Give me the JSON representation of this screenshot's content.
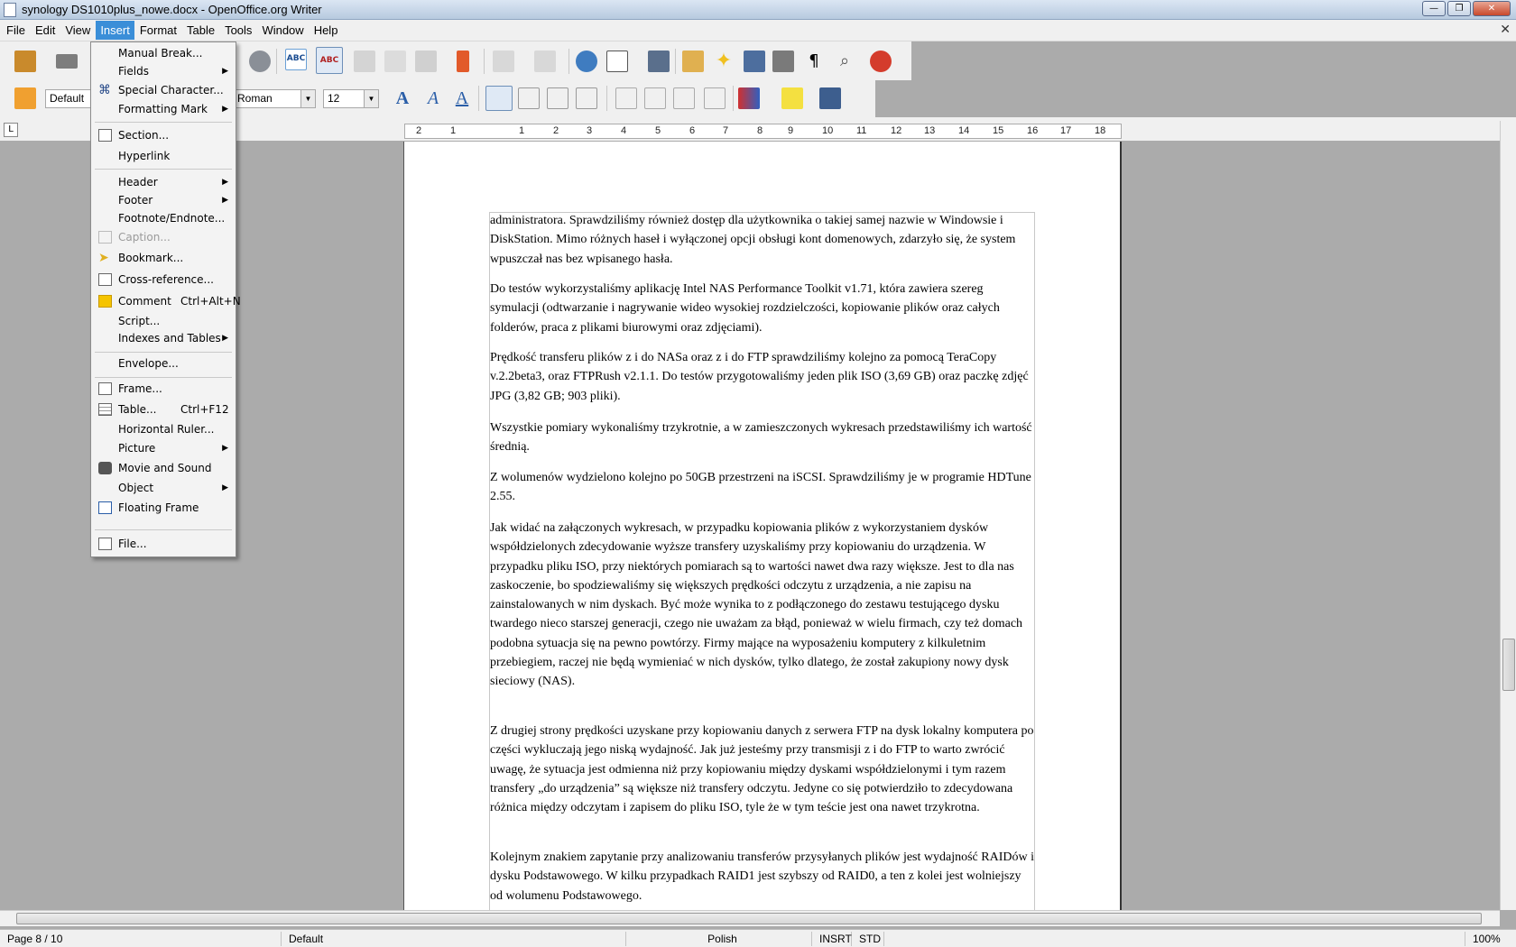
{
  "window": {
    "title": "synology DS1010plus_nowe.docx - OpenOffice.org Writer"
  },
  "menubar": {
    "items": [
      "File",
      "Edit",
      "View",
      "Insert",
      "Format",
      "Table",
      "Tools",
      "Window",
      "Help"
    ],
    "active": "Insert"
  },
  "formatting": {
    "style": "Default",
    "font": "Roman",
    "size": "12"
  },
  "ruler": {
    "labels": [
      "2",
      "1",
      "1",
      "2",
      "3",
      "4",
      "5",
      "6",
      "7",
      "8",
      "9",
      "10",
      "11",
      "12",
      "13",
      "14",
      "15",
      "16",
      "17",
      "18"
    ]
  },
  "insert_menu": {
    "items": [
      {
        "label": "Manual Break...",
        "icon": "",
        "submenu": false,
        "disabled": false,
        "shortcut": ""
      },
      {
        "label": "Fields",
        "icon": "",
        "submenu": true,
        "disabled": false,
        "shortcut": ""
      },
      {
        "label": "Special Character...",
        "icon": "special-char-icon",
        "submenu": false,
        "disabled": false,
        "shortcut": ""
      },
      {
        "label": "Formatting Mark",
        "icon": "",
        "submenu": true,
        "disabled": false,
        "shortcut": ""
      },
      {
        "label": "Section...",
        "icon": "section-icon",
        "submenu": false,
        "disabled": false,
        "shortcut": ""
      },
      {
        "label": "Hyperlink",
        "icon": "",
        "submenu": false,
        "disabled": false,
        "shortcut": ""
      },
      {
        "label": "Header",
        "icon": "",
        "submenu": true,
        "disabled": false,
        "shortcut": ""
      },
      {
        "label": "Footer",
        "icon": "",
        "submenu": true,
        "disabled": false,
        "shortcut": ""
      },
      {
        "label": "Footnote/Endnote...",
        "icon": "",
        "submenu": false,
        "disabled": false,
        "shortcut": ""
      },
      {
        "label": "Caption...",
        "icon": "caption-icon",
        "submenu": false,
        "disabled": true,
        "shortcut": ""
      },
      {
        "label": "Bookmark...",
        "icon": "bookmark-icon",
        "submenu": false,
        "disabled": false,
        "shortcut": ""
      },
      {
        "label": "Cross-reference...",
        "icon": "cross-reference-icon",
        "submenu": false,
        "disabled": false,
        "shortcut": ""
      },
      {
        "label": "Comment",
        "icon": "comment-icon",
        "submenu": false,
        "disabled": false,
        "shortcut": "Ctrl+Alt+N"
      },
      {
        "label": "Script...",
        "icon": "",
        "submenu": false,
        "disabled": false,
        "shortcut": ""
      },
      {
        "label": "Indexes and Tables",
        "icon": "",
        "submenu": true,
        "disabled": false,
        "shortcut": ""
      },
      {
        "label": "Envelope...",
        "icon": "",
        "submenu": false,
        "disabled": false,
        "shortcut": ""
      },
      {
        "label": "Frame...",
        "icon": "frame-icon",
        "submenu": false,
        "disabled": false,
        "shortcut": ""
      },
      {
        "label": "Table...",
        "icon": "table-icon",
        "submenu": false,
        "disabled": false,
        "shortcut": "Ctrl+F12"
      },
      {
        "label": "Horizontal Ruler...",
        "icon": "",
        "submenu": false,
        "disabled": false,
        "shortcut": ""
      },
      {
        "label": "Picture",
        "icon": "",
        "submenu": true,
        "disabled": false,
        "shortcut": ""
      },
      {
        "label": "Movie and Sound",
        "icon": "movie-icon",
        "submenu": false,
        "disabled": false,
        "shortcut": ""
      },
      {
        "label": "Object",
        "icon": "",
        "submenu": true,
        "disabled": false,
        "shortcut": ""
      },
      {
        "label": "Floating Frame",
        "icon": "floating-frame-icon",
        "submenu": false,
        "disabled": false,
        "shortcut": ""
      },
      {
        "label": "File...",
        "icon": "file-icon",
        "submenu": false,
        "disabled": false,
        "shortcut": ""
      }
    ]
  },
  "document": {
    "paragraphs": [
      "administratora. Sprawdziliśmy również dostęp dla użytkownika o takiej samej nazwie w Windowsie i DiskStation. Mimo różnych haseł i wyłączonej opcji obsługi kont domenowych, zdarzyło się, że system wpuszczał nas bez wpisanego hasła.",
      "Do testów wykorzystaliśmy aplikację Intel NAS Performance Toolkit v1.71, która zawiera szereg symulacji (odtwarzanie i nagrywanie wideo wysokiej rozdzielczości, kopiowanie plików oraz całych folderów, praca z plikami biurowymi oraz zdjęciami).",
      "Prędkość transferu plików z i do NASa oraz z i do FTP sprawdziliśmy kolejno za pomocą TeraCopy v.2.2beta3, oraz FTPRush v2.1.1. Do testów przygotowaliśmy jeden plik ISO (3,69 GB) oraz paczkę zdjęć JPG (3,82 GB; 903 pliki).",
      "Wszystkie pomiary wykonaliśmy trzykrotnie, a w zamieszczonych wykresach przedstawiliśmy ich wartość średnią.",
      "Z wolumenów wydzielono kolejno po 50GB przestrzeni na iSCSI. Sprawdziliśmy  je w programie HDTune 2.55.",
      "Jak widać na załączonych wykresach, w przypadku kopiowania plików z wykorzystaniem dysków współdzielonych zdecydowanie wyższe transfery uzyskaliśmy przy kopiowaniu do urządzenia. W przypadku pliku ISO, przy niektórych pomiarach są to wartości nawet dwa razy większe. Jest to dla nas zaskoczenie, bo spodziewaliśmy się większych prędkości odczytu z urządzenia, a nie zapisu na zainstalowanych w nim dyskach. Być może wynika to z podłączonego do zestawu testującego dysku twardego nieco starszej generacji, czego nie uważam za błąd, ponieważ w wielu firmach, czy też domach podobna sytuacja się na pewno powtórzy. Firmy mające na wyposażeniu komputery z kilkuletnim przebiegiem, raczej nie będą wymieniać w nich dysków, tylko dlatego, że został zakupiony nowy dysk sieciowy (NAS).",
      "Z drugiej strony prędkości uzyskane przy kopiowaniu danych z serwera FTP na dysk lokalny komputera po części wykluczają jego niską wydajność. Jak już jesteśmy przy transmisji z i do FTP to warto zwrócić uwagę, że sytuacja jest odmienna niż przy kopiowaniu między dyskami współdzielonymi i tym razem transfery „do urządzenia” są większe niż transfery odczytu. Jedyne co się potwierdziło to zdecydowana różnica między odczytam i zapisem do pliku ISO, tyle że w tym teście jest ona nawet trzykrotna.",
      "Kolejnym znakiem zapytanie przy analizowaniu transferów przysyłanych plików jest wydajność RAIDów i dysku Podstawowego. W kilku przypadkach RAID1 jest szybszy od RAID0, a ten z kolei jest wolniejszy od wolumenu Podstawowego."
    ]
  },
  "statusbar": {
    "page": "Page 8 / 10",
    "style": "Default",
    "language": "Polish",
    "mode": "INSRT",
    "selection": "STD",
    "zoom": "100%"
  }
}
